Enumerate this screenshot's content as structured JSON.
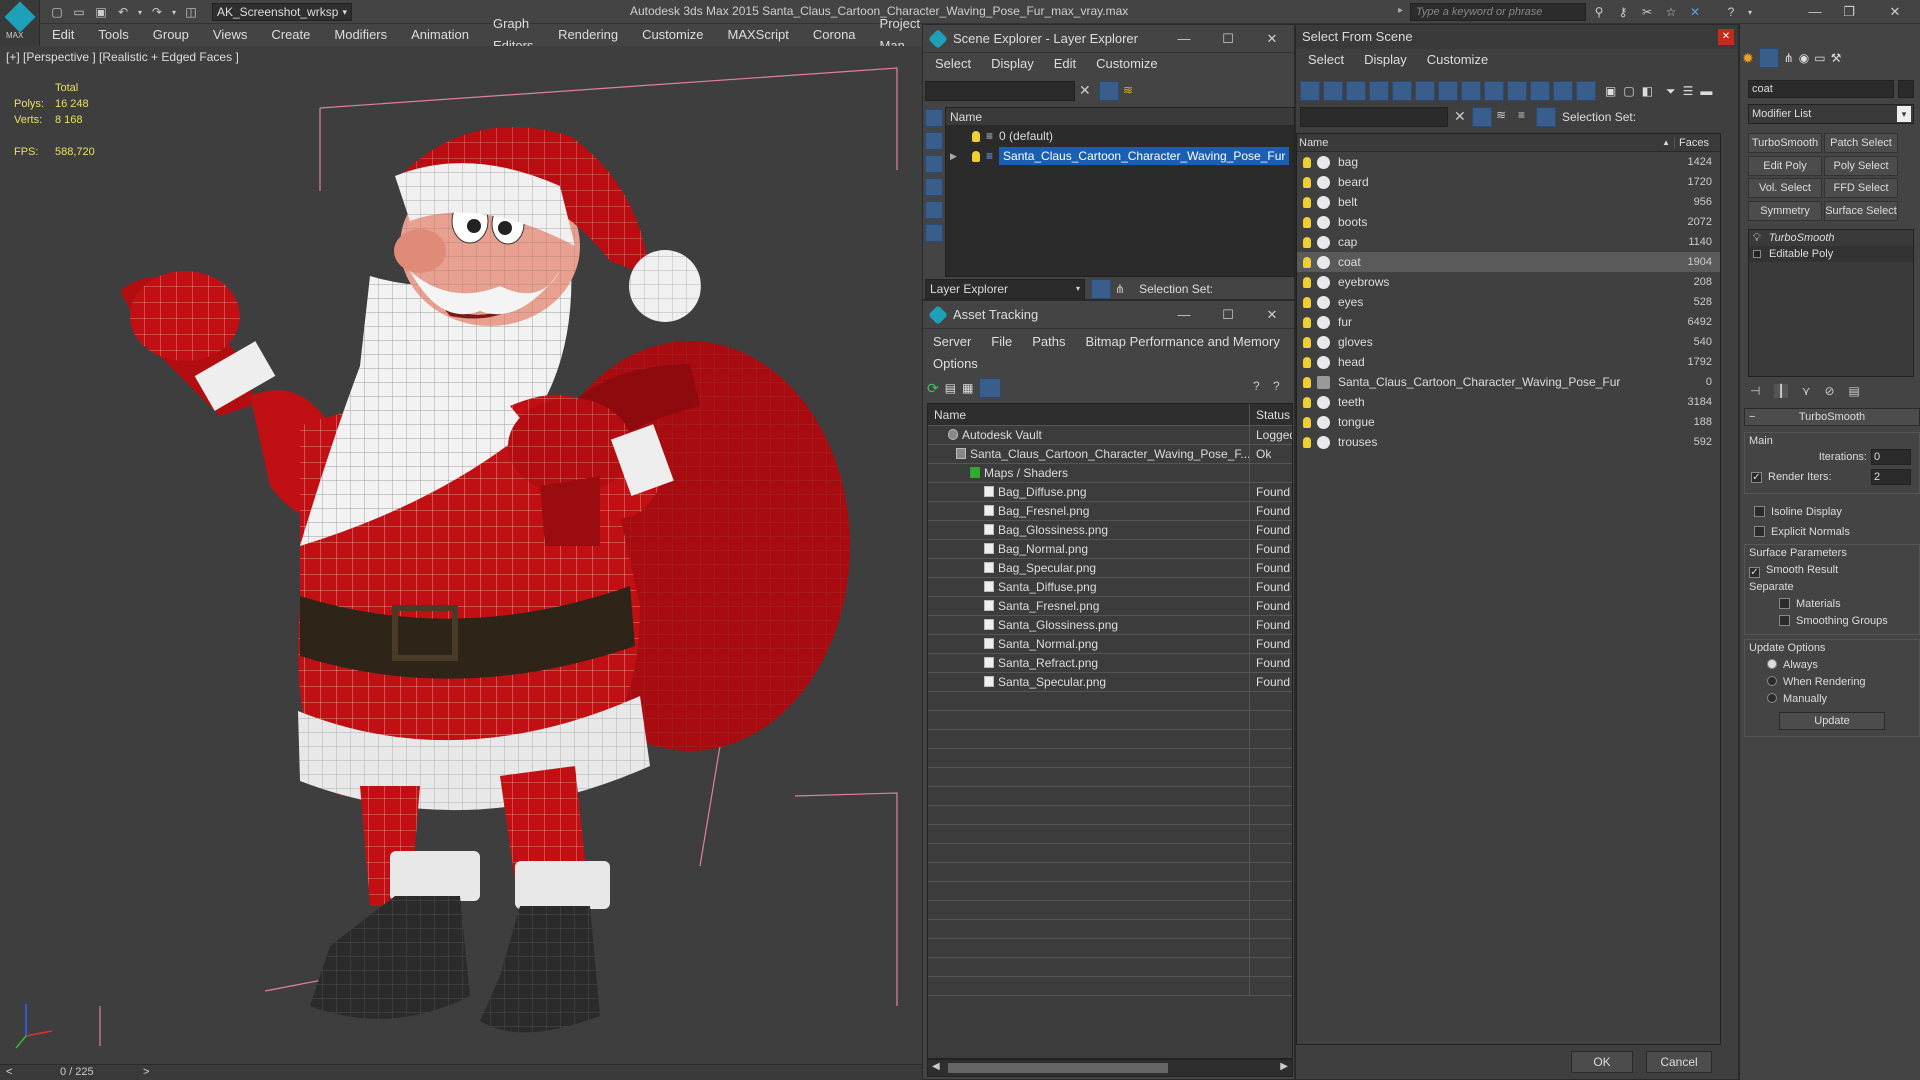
{
  "app": {
    "title": "Autodesk 3ds Max  2015     Santa_Claus_Cartoon_Character_Waving_Pose_Fur_max_vray.max",
    "logo": "MAX",
    "workspace": "AK_Screenshot_wrksp",
    "search_placeholder": "Type a keyword or phrase"
  },
  "menu": [
    "Edit",
    "Tools",
    "Group",
    "Views",
    "Create",
    "Modifiers",
    "Animation",
    "Graph Editors",
    "Rendering",
    "Customize",
    "MAXScript",
    "Corona",
    "Project Man"
  ],
  "viewport": {
    "label": "[+] [Perspective ] [Realistic + Edged Faces ]",
    "stats": {
      "total_label": "Total",
      "polys_label": "Polys:",
      "polys": "16 248",
      "verts_label": "Verts:",
      "verts": "8 168",
      "fps_label": "FPS:",
      "fps": "588,720"
    }
  },
  "timeline": {
    "frame": "0 / 225",
    "prev": "<",
    "next": ">"
  },
  "scene_explorer": {
    "title": "Scene Explorer - Layer Explorer",
    "menu": [
      "Select",
      "Display",
      "Edit",
      "Customize"
    ],
    "column": "Name",
    "layers": [
      "0 (default)",
      "Santa_Claus_Cartoon_Character_Waving_Pose_Fur"
    ],
    "footer_label": "Layer Explorer",
    "selection_set": "Selection Set:"
  },
  "asset_tracking": {
    "title": "Asset Tracking",
    "menu": [
      "Server",
      "File",
      "Paths",
      "Bitmap Performance and Memory",
      "Options"
    ],
    "columns": [
      "Name",
      "Status"
    ],
    "rows": [
      {
        "name": "Autodesk Vault",
        "status": "Logged",
        "indent": 0
      },
      {
        "name": "Santa_Claus_Cartoon_Character_Waving_Pose_F...",
        "status": "Ok",
        "indent": 1
      },
      {
        "name": "Maps / Shaders",
        "status": "",
        "indent": 2
      },
      {
        "name": "Bag_Diffuse.png",
        "status": "Found",
        "indent": 3
      },
      {
        "name": "Bag_Fresnel.png",
        "status": "Found",
        "indent": 3
      },
      {
        "name": "Bag_Glossiness.png",
        "status": "Found",
        "indent": 3
      },
      {
        "name": "Bag_Normal.png",
        "status": "Found",
        "indent": 3
      },
      {
        "name": "Bag_Specular.png",
        "status": "Found",
        "indent": 3
      },
      {
        "name": "Santa_Diffuse.png",
        "status": "Found",
        "indent": 3
      },
      {
        "name": "Santa_Fresnel.png",
        "status": "Found",
        "indent": 3
      },
      {
        "name": "Santa_Glossiness.png",
        "status": "Found",
        "indent": 3
      },
      {
        "name": "Santa_Normal.png",
        "status": "Found",
        "indent": 3
      },
      {
        "name": "Santa_Refract.png",
        "status": "Found",
        "indent": 3
      },
      {
        "name": "Santa_Specular.png",
        "status": "Found",
        "indent": 3
      }
    ]
  },
  "select_from_scene": {
    "title": "Select From Scene",
    "menu": [
      "Select",
      "Display",
      "Customize"
    ],
    "selection_set": "Selection Set:",
    "columns": [
      "Name",
      "Faces"
    ],
    "objects": [
      {
        "name": "bag",
        "faces": "1424"
      },
      {
        "name": "beard",
        "faces": "1720"
      },
      {
        "name": "belt",
        "faces": "956"
      },
      {
        "name": "boots",
        "faces": "2072"
      },
      {
        "name": "cap",
        "faces": "1140"
      },
      {
        "name": "coat",
        "faces": "1904",
        "selected": true
      },
      {
        "name": "eyebrows",
        "faces": "208"
      },
      {
        "name": "eyes",
        "faces": "528"
      },
      {
        "name": "fur",
        "faces": "6492"
      },
      {
        "name": "gloves",
        "faces": "540"
      },
      {
        "name": "head",
        "faces": "1792"
      },
      {
        "name": "Santa_Claus_Cartoon_Character_Waving_Pose_Fur",
        "faces": "0"
      },
      {
        "name": "teeth",
        "faces": "3184"
      },
      {
        "name": "tongue",
        "faces": "188"
      },
      {
        "name": "trouses",
        "faces": "592"
      }
    ],
    "ok": "OK",
    "cancel": "Cancel"
  },
  "command_panel": {
    "object_name": "coat",
    "modifier_list": "Modifier List",
    "mod_buttons": [
      "TurboSmooth",
      "Patch Select",
      "Edit Poly",
      "Poly Select",
      "Vol. Select",
      "FFD Select",
      "Symmetry",
      "Surface Select"
    ],
    "stack": [
      "TurboSmooth",
      "Editable Poly"
    ],
    "rollout_title": "TurboSmooth",
    "main_label": "Main",
    "iterations_label": "Iterations:",
    "iterations": "0",
    "render_iters_label": "Render Iters:",
    "render_iters": "2",
    "isoline": "Isoline Display",
    "explicit": "Explicit Normals",
    "surface_params": "Surface Parameters",
    "smooth_result": "Smooth Result",
    "separate": "Separate",
    "materials": "Materials",
    "smoothing_groups": "Smoothing Groups",
    "update_options": "Update Options",
    "always": "Always",
    "when_rendering": "When Rendering",
    "manually": "Manually",
    "update": "Update"
  }
}
